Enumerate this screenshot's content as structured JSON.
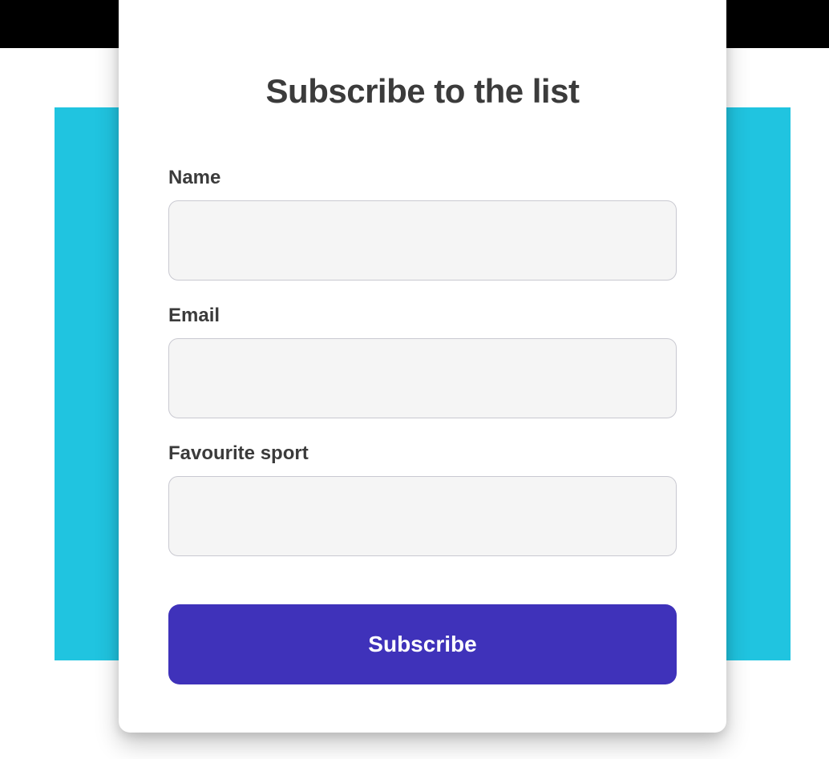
{
  "form": {
    "title": "Subscribe to the list",
    "fields": {
      "name": {
        "label": "Name",
        "value": ""
      },
      "email": {
        "label": "Email",
        "value": ""
      },
      "sport": {
        "label": "Favourite sport",
        "value": ""
      }
    },
    "submit_label": "Subscribe"
  },
  "colors": {
    "accent": "#3f32ba",
    "bg_cyan": "#20c4e0",
    "input_bg": "#f5f5f5",
    "text": "#3b3b3b"
  }
}
